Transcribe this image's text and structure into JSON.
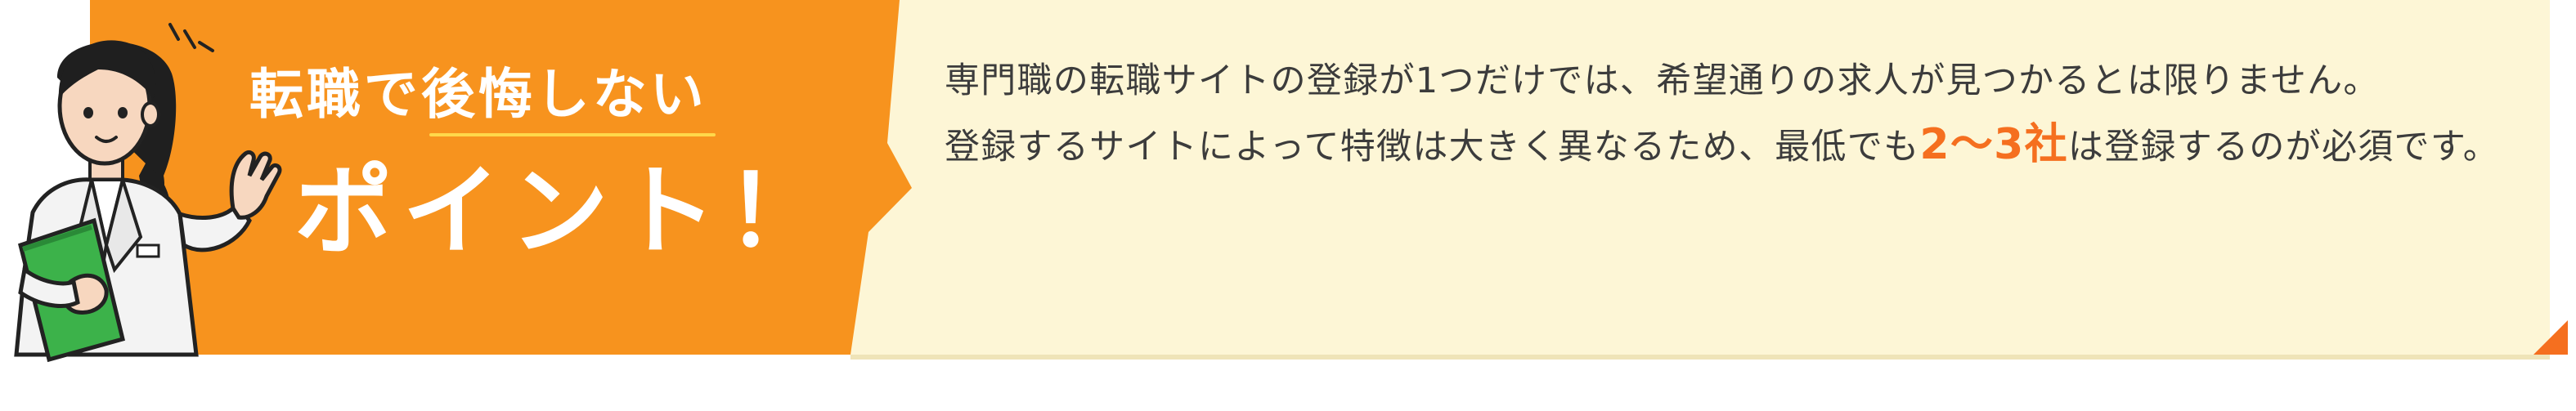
{
  "headline": {
    "line1": "転職で後悔しない",
    "line2": "ポイント！"
  },
  "body": {
    "part1": "専門職の転職サイトの登録が1つだけでは、希望通りの求人が見つかるとは限りません。",
    "part2": "登録するサイトによって特徴は大きく異なるため、最低でも",
    "highlight": "2〜3社",
    "part3": "は登録するのが必須です。"
  },
  "colors": {
    "orange": "#f7931e",
    "cream": "#fdf6d6",
    "highlight": "#f56f1f",
    "text": "#3c3c3c",
    "folder": "#3cb24a",
    "skin": "#f7d7bf",
    "hair": "#1f1f1f"
  },
  "icons": {
    "character": "businesswoman-with-folder-illustration",
    "corner": "corner-triangle-icon",
    "pointer": "right-pointer-icon"
  }
}
